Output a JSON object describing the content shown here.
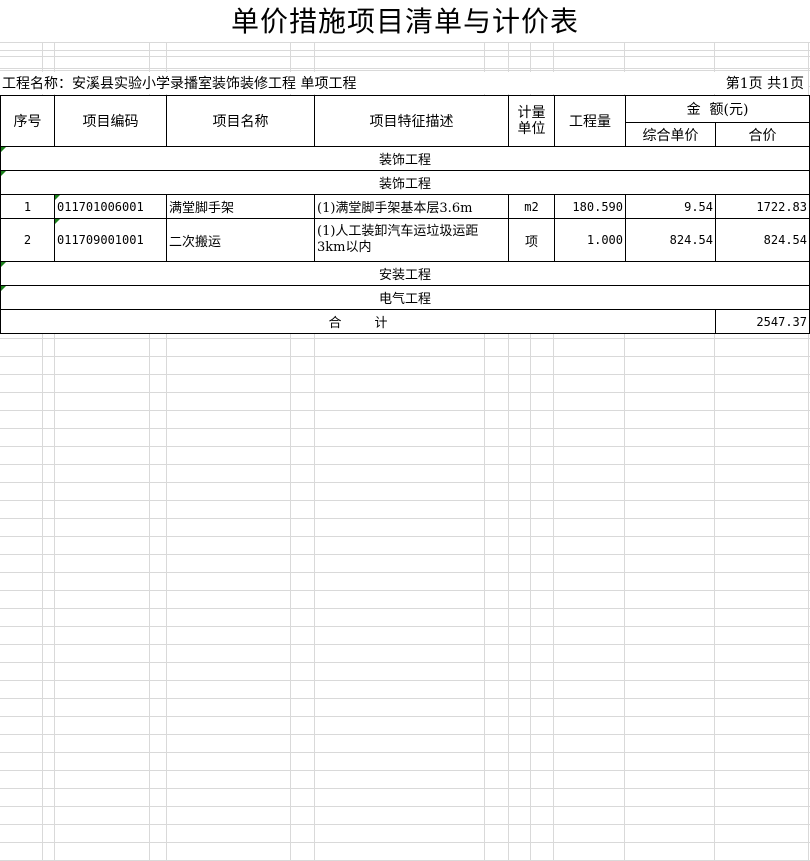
{
  "title": "单价措施项目清单与计价表",
  "info": {
    "project": "工程名称：安溪县实验小学录播室装饰装修工程 单项工程",
    "page": "第1页  共1页"
  },
  "headers": {
    "seq": "序号",
    "code": "项目编码",
    "name": "项目名称",
    "desc": "项目特征描述",
    "unit": "计量单位",
    "qty": "工程量",
    "amount": "金  额(元)",
    "unit_price": "综合单价",
    "total": "合价"
  },
  "sections": {
    "s1": "装饰工程",
    "s2": "装饰工程",
    "s3": "安装工程",
    "s4": "电气工程"
  },
  "rows": [
    {
      "seq": "1",
      "code": "011701006001",
      "name": "满堂脚手架",
      "desc": "(1)满堂脚手架基本层3.6m",
      "unit": "m2",
      "qty": "180.590",
      "price": "9.54",
      "total": "1722.83"
    },
    {
      "seq": "2",
      "code": "011709001001",
      "name": "二次搬运",
      "desc": "(1)人工装卸汽车运垃圾运距3km以内",
      "unit": "项",
      "qty": "1.000",
      "price": "824.54",
      "total": "824.54"
    }
  ],
  "summary": {
    "label": "合        计",
    "total": "2547.37"
  }
}
